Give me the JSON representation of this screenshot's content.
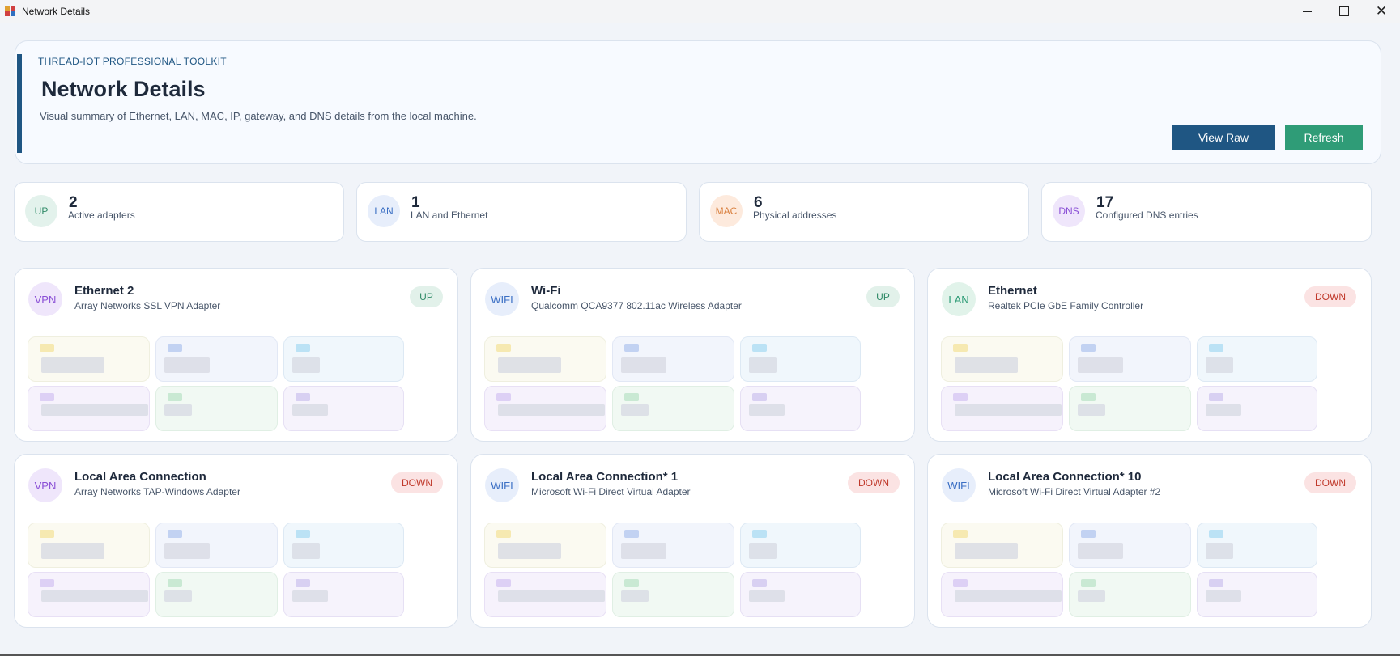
{
  "window": {
    "title": "Network Details"
  },
  "header": {
    "eyebrow": "THREAD-IOT PROFESSIONAL TOOLKIT",
    "title": "Network Details",
    "subtitle": "Visual summary of Ethernet, LAN, MAC, IP, gateway, and DNS details from the local machine.",
    "view_raw_label": "View Raw",
    "refresh_label": "Refresh"
  },
  "stats": [
    {
      "tag": "UP",
      "value": "2",
      "label": "Active adapters",
      "bg": "#e3f2ec",
      "fg": "#2f8a67"
    },
    {
      "tag": "LAN",
      "value": "1",
      "label": "LAN and Ethernet",
      "bg": "#e7eefb",
      "fg": "#3b6fc4"
    },
    {
      "tag": "MAC",
      "value": "6",
      "label": "Physical addresses",
      "bg": "#fdeadd",
      "fg": "#d9803f"
    },
    {
      "tag": "DNS",
      "value": "17",
      "label": "Configured DNS entries",
      "bg": "#efe6fb",
      "fg": "#8a4fd6"
    }
  ],
  "adapters": [
    {
      "tag": "VPN",
      "name": "Ethernet 2",
      "description": "Array Networks SSL VPN Adapter",
      "status": "UP",
      "tag_bg": "#efe6fb",
      "tag_fg": "#8a4fd6"
    },
    {
      "tag": "WIFI",
      "name": "Wi-Fi",
      "description": "Qualcomm QCA9377 802.11ac Wireless Adapter",
      "status": "UP",
      "tag_bg": "#e7eefb",
      "tag_fg": "#3b6fc4"
    },
    {
      "tag": "LAN",
      "name": "Ethernet",
      "description": "Realtek PCIe GbE Family Controller",
      "status": "DOWN",
      "tag_bg": "#e1f3ea",
      "tag_fg": "#2f9c77"
    },
    {
      "tag": "VPN",
      "name": "Local Area Connection",
      "description": "Array Networks TAP-Windows Adapter",
      "status": "DOWN",
      "tag_bg": "#efe6fb",
      "tag_fg": "#8a4fd6"
    },
    {
      "tag": "WIFI",
      "name": "Local Area Connection* 1",
      "description": "Microsoft Wi-Fi Direct Virtual Adapter",
      "status": "DOWN",
      "tag_bg": "#e7eefb",
      "tag_fg": "#3b6fc4"
    },
    {
      "tag": "WIFI",
      "name": "Local Area Connection* 10",
      "description": "Microsoft Wi-Fi Direct Virtual Adapter #2",
      "status": "DOWN",
      "tag_bg": "#e7eefb",
      "tag_fg": "#3b6fc4"
    }
  ]
}
